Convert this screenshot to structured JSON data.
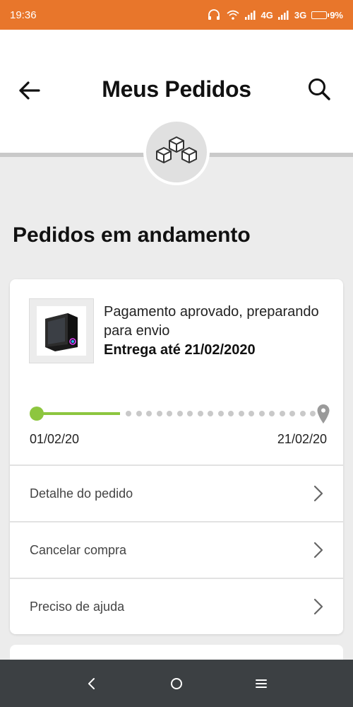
{
  "status_bar": {
    "time": "19:36",
    "network_1": "4G",
    "network_2": "3G",
    "battery": "9%"
  },
  "header": {
    "title": "Meus Pedidos",
    "back_icon": "arrow-left-icon",
    "search_icon": "search-icon",
    "badge_icon": "boxes-icon"
  },
  "section": {
    "title": "Pedidos em andamento"
  },
  "order": {
    "status_text": "Pagamento aprovado, preparando para envio",
    "delivery_text": "Entrega até 21/02/2020",
    "progress": {
      "start_date": "01/02/20",
      "end_date": "21/02/20",
      "fraction_complete": 0.25
    },
    "actions": [
      {
        "label": "Detalhe do pedido"
      },
      {
        "label": "Cancelar compra"
      },
      {
        "label": "Preciso de ajuda"
      }
    ]
  },
  "colors": {
    "status_bar": "#e8762b",
    "progress_done": "#8dc63f",
    "progress_pending": "#c9c9c9",
    "nav_bar": "#3c4043"
  }
}
